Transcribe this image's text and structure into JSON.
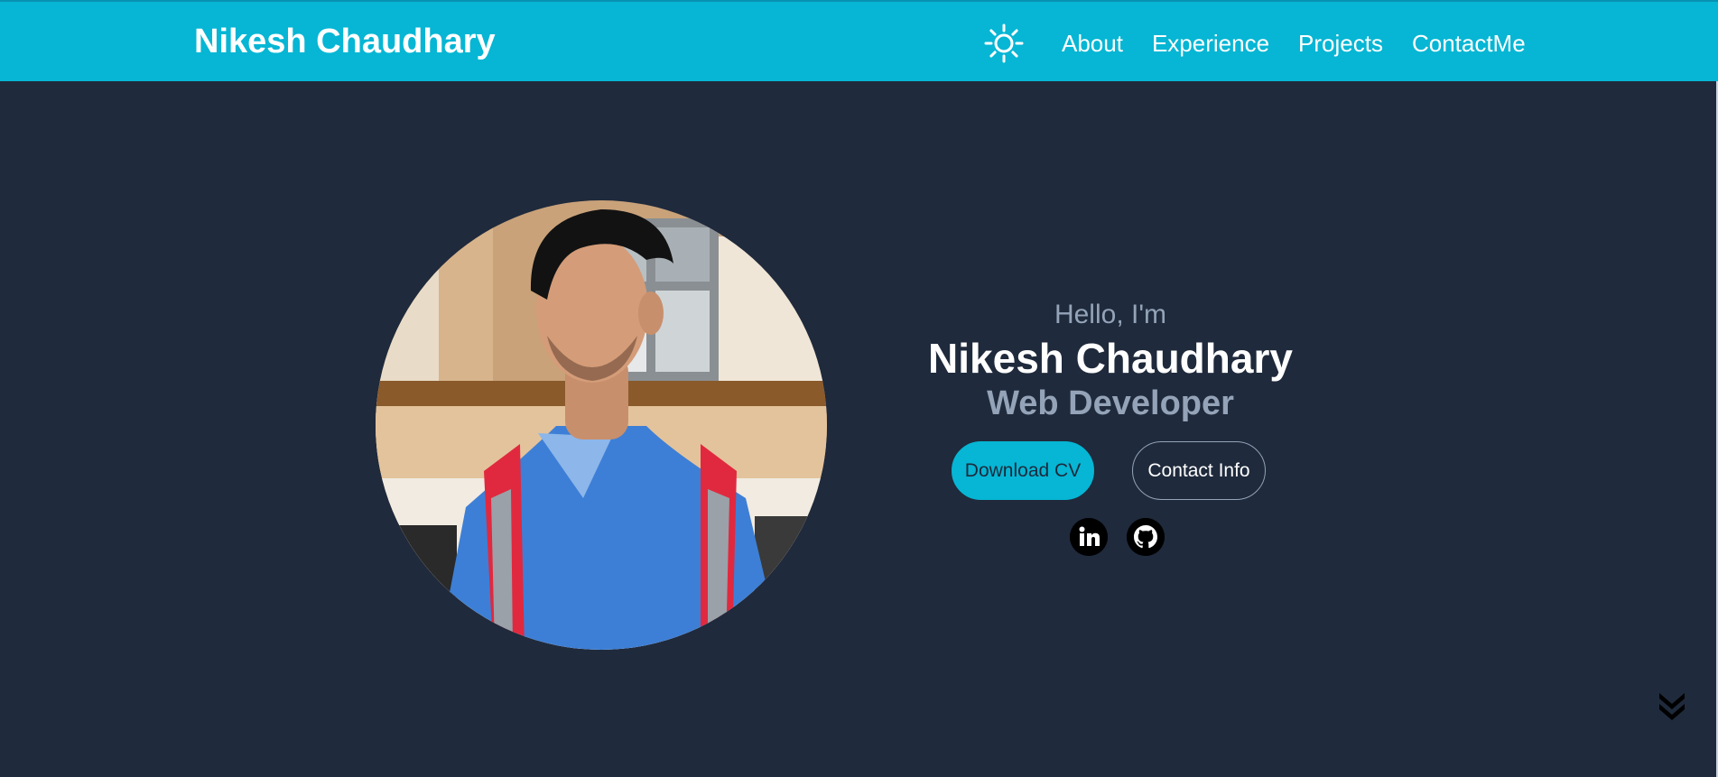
{
  "colors": {
    "nav_bg": "#06b6d4",
    "page_bg": "#1f2a3c",
    "accent": "#06b6d4",
    "muted_text": "#94a3b8",
    "white": "#ffffff"
  },
  "navbar": {
    "brand": "Nikesh Chaudhary",
    "theme_icon": "sun-icon",
    "links": [
      {
        "label": "About"
      },
      {
        "label": "Experience"
      },
      {
        "label": "Projects"
      },
      {
        "label": "ContactMe"
      }
    ]
  },
  "hero": {
    "greeting": "Hello, I'm",
    "name": "Nikesh Chaudhary",
    "role": "Web Developer",
    "buttons": {
      "download_cv": "Download CV",
      "contact_info": "Contact Info"
    },
    "social": [
      {
        "icon": "linkedin-icon"
      },
      {
        "icon": "github-icon"
      }
    ],
    "scroll_icon": "double-chevron-down-icon"
  }
}
